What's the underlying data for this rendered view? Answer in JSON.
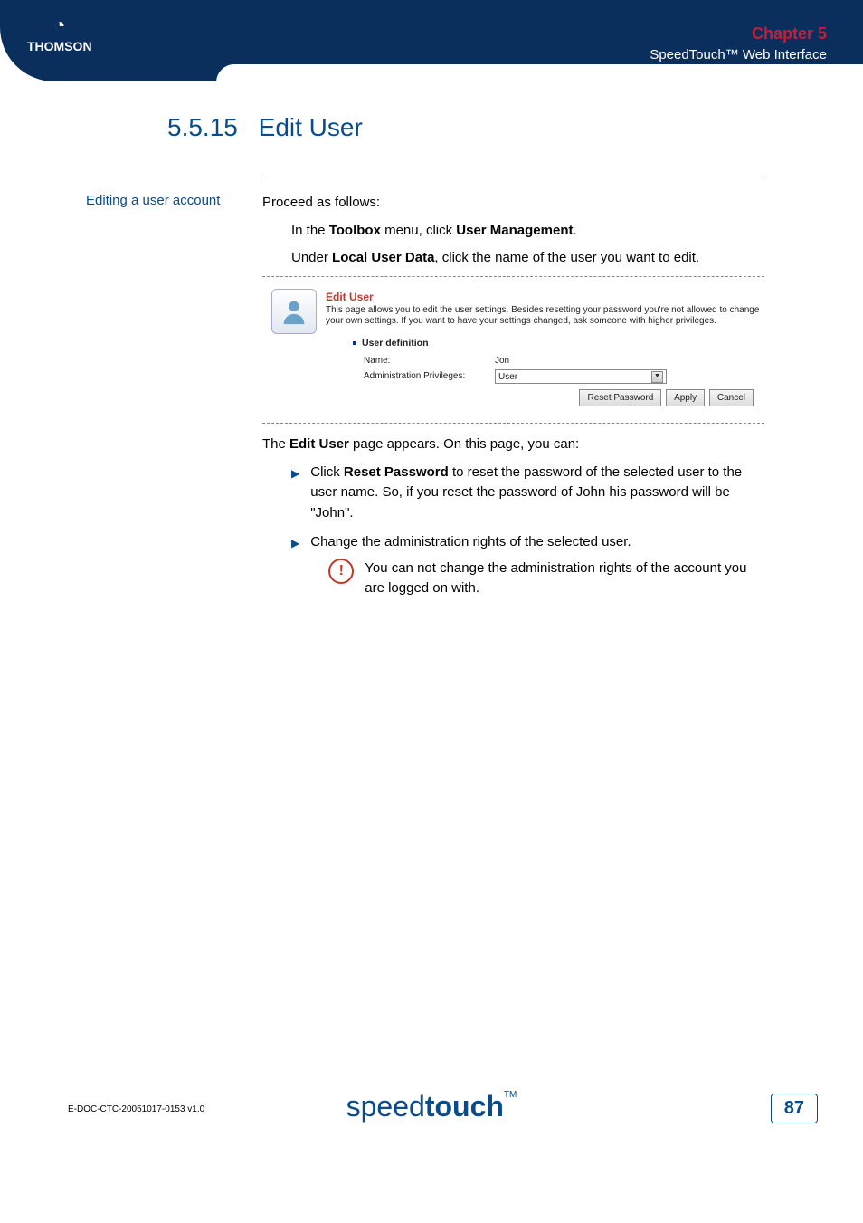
{
  "header": {
    "brand": "THOMSON",
    "chapter": "Chapter 5",
    "subtitle": "SpeedTouch™ Web Interface"
  },
  "section": {
    "number": "5.5.15",
    "title": "Edit User"
  },
  "sidebar_label": "Editing a user account",
  "body": {
    "intro": "Proceed as follows:",
    "step1_pre": "In the ",
    "step1_b1": "Toolbox",
    "step1_mid": " menu, click ",
    "step1_b2": "User Management",
    "step1_post": ".",
    "step2_pre": "Under ",
    "step2_b1": "Local User Data",
    "step2_post": ", click the name of the user you want to edit."
  },
  "embed": {
    "title": "Edit User",
    "desc": "This page allows you to edit the user settings. Besides resetting your password you're not allowed to change your own settings. If you want to have your settings changed, ask someone with higher privileges.",
    "section_title": "User definition",
    "name_label": "Name:",
    "name_value": "Jon",
    "priv_label": "Administration Privileges:",
    "priv_value": "User",
    "btn_reset": "Reset Password",
    "btn_apply": "Apply",
    "btn_cancel": "Cancel"
  },
  "after": {
    "line_pre": "The ",
    "line_b": "Edit User",
    "line_post": " page appears. On this page, you can:",
    "bullet1_pre": "Click ",
    "bullet1_b": "Reset Password",
    "bullet1_post": " to reset the password of the selected user to the user name. So, if you reset the password of John his password will be \"John\".",
    "bullet2": "Change the administration rights of the selected user.",
    "note": "You can not change the administration rights of the account you are logged on with."
  },
  "footer": {
    "docid": "E-DOC-CTC-20051017-0153 v1.0",
    "logo_thin": "speed",
    "logo_bold": "touch",
    "tm": "TM",
    "page": "87"
  }
}
